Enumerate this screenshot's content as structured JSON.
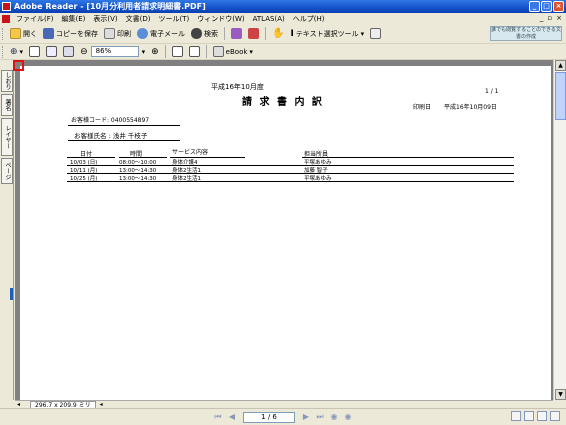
{
  "window": {
    "title": "Adobe Reader - [10月分利用者請求明細書.PDF]"
  },
  "menu": [
    "ファイル(F)",
    "編集(E)",
    "表示(V)",
    "文書(D)",
    "ツール(T)",
    "ウィンドウ(W)",
    "ATLAS(A)",
    "ヘルプ(H)"
  ],
  "toolbar": {
    "open": "開く",
    "save_copy": "コピーを保存",
    "print": "印刷",
    "email": "電子メール",
    "search": "検索",
    "text_select": "テキスト選択ツール",
    "zoom": "86%",
    "ebook": "eBook",
    "hint": "誰でも閲覧することのできる文書の作成"
  },
  "nav_tabs": [
    "しおり",
    "署名",
    "レイヤー",
    "ページ"
  ],
  "document": {
    "date_title": "平成16年10月度",
    "title": "請 求 書 内 訳",
    "page_no": "1 / 1",
    "print_date_label": "印刷日",
    "print_date": "平成16年10月09日",
    "customer_code": "お客様コード: 0400554897",
    "customer_name": "お客様氏名 : 浅井 千枝子",
    "headers": [
      "日付",
      "時間",
      "サービス内容",
      "担当所員"
    ],
    "rows": [
      [
        "10/03 (日)",
        "08:00～10:00",
        "身体介護4",
        "平塚あゆみ"
      ],
      [
        "10/11 (月)",
        "13:00～14:30",
        "身体2生活1",
        "加藤 智子"
      ],
      [
        "10/25 (月)",
        "13:00～14:30",
        "身体2生活1",
        "平塚あゆみ"
      ]
    ]
  },
  "status": {
    "page_size": "296.7 x 209.9 ミリ",
    "page_field": "1 / 6"
  }
}
